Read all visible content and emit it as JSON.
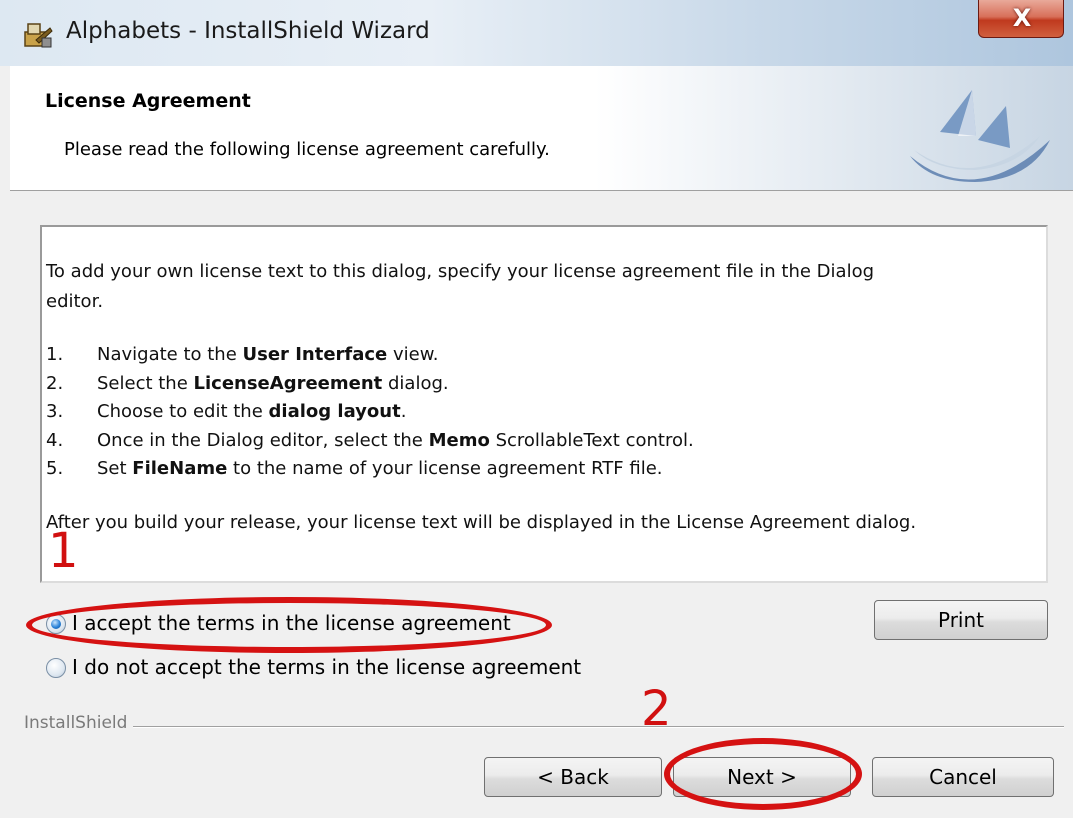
{
  "window": {
    "title": "Alphabets - InstallShield Wizard",
    "close_glyph": "X"
  },
  "banner": {
    "title": "License Agreement",
    "subtitle": "Please read the following license agreement carefully."
  },
  "license": {
    "intro": "To add your own license text to this dialog, specify your license agreement file in the Dialog",
    "intro_cont": "editor.",
    "steps": [
      {
        "num": "1.",
        "pre": "Navigate to the ",
        "bold": "User Interface",
        "post": " view."
      },
      {
        "num": "2.",
        "pre": "Select the ",
        "bold": "LicenseAgreement",
        "post": " dialog."
      },
      {
        "num": "3.",
        "pre": "Choose to edit the ",
        "bold": "dialog layout",
        "post": "."
      },
      {
        "num": "4.",
        "pre": "Once in the Dialog editor, select the ",
        "bold": "Memo",
        "post": " ScrollableText control."
      },
      {
        "num": "5.",
        "pre": "Set ",
        "bold": "FileName",
        "post": " to the name of your license agreement RTF file."
      }
    ],
    "outro": "After you build your release, your license text will be displayed in the License Agreement dialog."
  },
  "options": {
    "accept_label": "I accept the terms in the license agreement",
    "decline_label": "I do not accept the terms in the license agreement",
    "selected": "accept"
  },
  "buttons": {
    "print": "Print",
    "back": "< Back",
    "next": "Next >",
    "cancel": "Cancel"
  },
  "footer": {
    "brand": "InstallShield"
  },
  "annotations": {
    "marker_1": "1",
    "marker_2": "2",
    "color": "#d11010"
  }
}
